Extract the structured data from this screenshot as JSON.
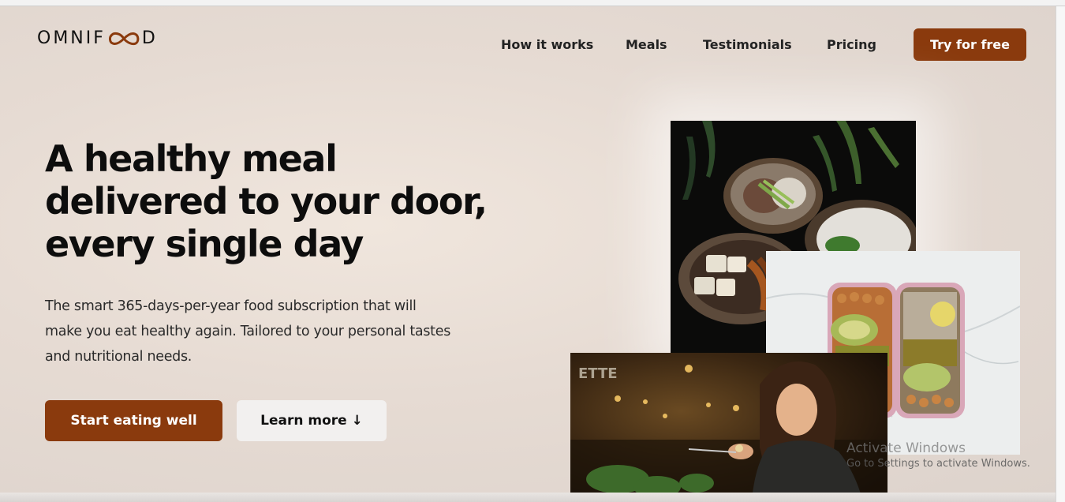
{
  "logo": {
    "text_left": "OMNIF",
    "text_right": "D"
  },
  "nav": {
    "links": [
      "How it works",
      "Meals",
      "Testimonials",
      "Pricing"
    ],
    "cta_label": "Try for free"
  },
  "hero": {
    "title_lines": [
      "A healthy meal",
      "delivered to your door,",
      "every single day"
    ],
    "subtitle_lines": [
      "The smart 365-days-per-year food subscription that will",
      "make you eat healthy again. Tailored to your personal tastes",
      "and nutritional needs."
    ],
    "primary_button": "Start eating well",
    "secondary_button": "Learn more ↓"
  },
  "photos": {
    "woman_sign_text": "ETTE"
  },
  "watermark": {
    "line1": "Activate Windows",
    "line2": "Go to Settings to activate Windows."
  },
  "colors": {
    "accent": "#8a3a0d",
    "background": "#e6dbd3",
    "text": "#0d0d0d"
  }
}
